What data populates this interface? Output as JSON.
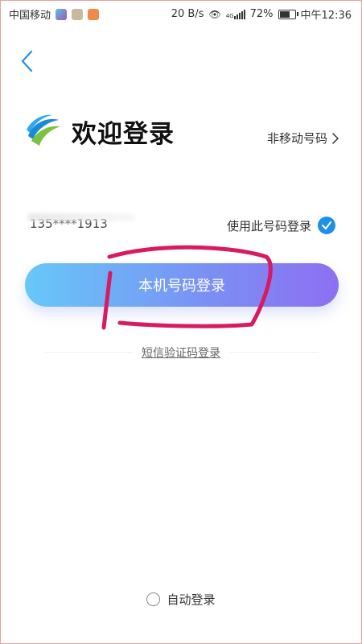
{
  "status_bar": {
    "carrier": "中国移动",
    "speed": "20 B/s",
    "network": "4G",
    "battery": "72%",
    "battery_level": 0.72,
    "time": "中午12:36"
  },
  "header": {
    "title": "欢迎登录",
    "other_number_link": "非移动号码"
  },
  "phone": {
    "number": "135****1913",
    "use_this_number": "使用此号码登录"
  },
  "actions": {
    "main_login": "本机号码登录",
    "sms_login": "短信验证码登录"
  },
  "footer": {
    "auto_login": "自动登录"
  },
  "colors": {
    "accent_blue": "#1e90e8",
    "button_start": "#67c8f8",
    "button_end": "#8e6ff2",
    "annotation": "#d81b60"
  }
}
